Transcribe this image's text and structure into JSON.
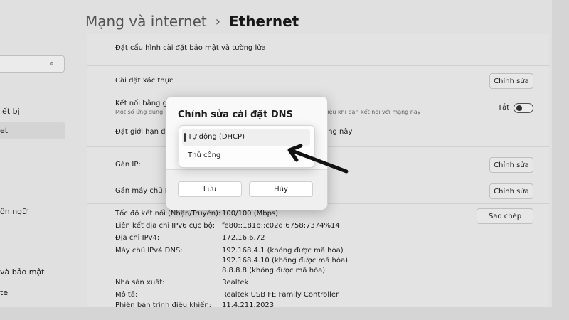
{
  "header": {
    "parent": "Mạng và internet",
    "separator": "›",
    "current": "Ethernet"
  },
  "sidebar": {
    "search_icon": "search-icon",
    "items": [
      {
        "label": "iết bị",
        "active": false
      },
      {
        "label": "et",
        "active": true
      },
      {
        "label": "ôn ngữ",
        "active": false
      },
      {
        "label": "và bảo mật",
        "active": false
      },
      {
        "label": "te",
        "active": false
      }
    ]
  },
  "settings": {
    "security_text": "Đặt cấu hình cài đặt bảo mật và tường lửa",
    "auth_label": "Cài đặt xác thực",
    "edit_label": "Chỉnh sửa",
    "metered_label": "Kết nối bằng gó",
    "metered_sub_left": "Một số ứng dụng",
    "metered_sub_right": "liệu khi bạn kết nối với mạng này",
    "toggle_state": "Tắt",
    "limit_label_left": "Đặt giới hạn dữ",
    "limit_label_right": "ang này",
    "ip_label": "Gán IP:",
    "dns_label": "Gán máy chủ D",
    "copy_label": "Sao chép"
  },
  "properties": [
    {
      "label": "Tốc độ kết nối (Nhận/Truyền):",
      "value": "100/100 (Mbps)"
    },
    {
      "label": "Liên kết địa chỉ IPv6 cục bộ:",
      "value": "fe80::181b::c02d:6758:7374%14"
    },
    {
      "label": "Địa chỉ IPv4:",
      "value": "172.16.6.72"
    },
    {
      "label": "Máy chủ IPv4 DNS:",
      "value": "192.168.4.1 (không được mã hóa)"
    },
    {
      "label": "",
      "value": "192.168.4.10 (không được mã hóa)"
    },
    {
      "label": "",
      "value": "8.8.8.8 (không được mã hóa)"
    },
    {
      "label": "Nhà sản xuất:",
      "value": "Realtek"
    },
    {
      "label": "Mô tả:",
      "value": "Realtek USB FE Family Controller"
    },
    {
      "label": "Phiên bản trình điều khiển:",
      "value": "11.4.211.2023"
    }
  ],
  "dialog": {
    "title": "Chỉnh sửa cài đặt DNS",
    "options": [
      "Tự động (DHCP)",
      "Thủ công"
    ],
    "selected": "Tự động (DHCP)",
    "save_label": "Lưu",
    "cancel_label": "Hủy"
  },
  "colors": {
    "arrow": "#111111",
    "accent": "#333333"
  }
}
